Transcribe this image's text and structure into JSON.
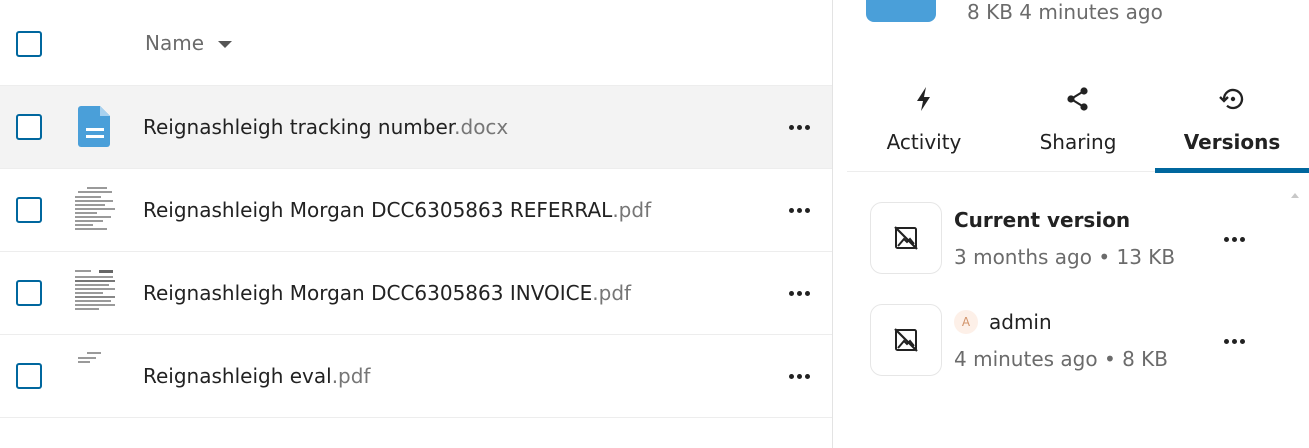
{
  "file_list": {
    "header": {
      "name_label": "Name"
    },
    "files": [
      {
        "name": "Reignashleigh tracking number",
        "ext": ".docx",
        "type": "document"
      },
      {
        "name": "Reignashleigh Morgan DCC6305863 REFERRAL",
        "ext": ".pdf",
        "type": "pdf"
      },
      {
        "name": "Reignashleigh Morgan DCC6305863 INVOICE",
        "ext": ".pdf",
        "type": "pdf"
      },
      {
        "name": "Reignashleigh eval",
        "ext": ".pdf",
        "type": "pdf"
      }
    ]
  },
  "sidebar": {
    "file_meta": "8 KB 4 minutes ago",
    "tabs": [
      {
        "label": "Activity",
        "icon": "lightning-icon"
      },
      {
        "label": "Sharing",
        "icon": "share-icon"
      },
      {
        "label": "Versions",
        "icon": "history-icon",
        "selected": true
      }
    ],
    "versions": [
      {
        "title": "Current version",
        "time": "3 months ago",
        "size": "13 KB",
        "sub": "3 months ago  •  13 KB"
      },
      {
        "author_initial": "A",
        "author": "admin",
        "time": "4 minutes ago",
        "size": "8 KB",
        "sub": "4 minutes ago  •  8 KB"
      }
    ]
  },
  "colors": {
    "accent": "#00679e",
    "folder_blue": "#4a9fd9",
    "doc_blue": "#4a9fd9",
    "row_highlight": "#f3f3f3"
  }
}
